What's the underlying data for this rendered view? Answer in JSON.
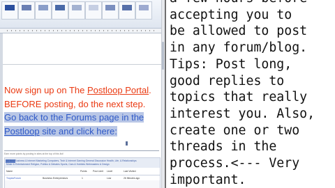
{
  "instructions": {
    "plain_1": "Now sign up on The ",
    "link_postloop_portal": "Postloop Portal",
    "plain_2": ".",
    "plain_3": "BEFORE posting, do the next step. ",
    "highlight_1": "Go back to the Forums page in the ",
    "link_postloop": "Postloop",
    "highlight_2": " site and click here:"
  },
  "forum_embed": {
    "caption": "Earn more points by posting in sites at the top of this list!",
    "tabs_row1": "All   New   Business & Internet Marketing   Computers, Tech & Internet   Gaming   General Discussion   Health, Life, & Relationships",
    "tabs_row2": "Music & Entertainment   Religion, Politics & Debates   Sports, Cars & Hobbies   Webmasters & Design",
    "columns": [
      "Name",
      "Points",
      "Post Limit",
      "Level",
      "Last Visited"
    ],
    "row": [
      "TropicsForum",
      "Business Entrepreneurs",
      "1",
      "Low",
      "26 Minutes ago"
    ]
  },
  "notes": {
    "lines": [
      "a few hours before",
      "accepting you to",
      "be allowed to post",
      "in any forum/blog.",
      "Tips: Post long,",
      "good replies to",
      "topics that really",
      "interest you. Also,",
      "create one or two",
      "threads in the",
      "process.<--- Very",
      "important."
    ]
  }
}
